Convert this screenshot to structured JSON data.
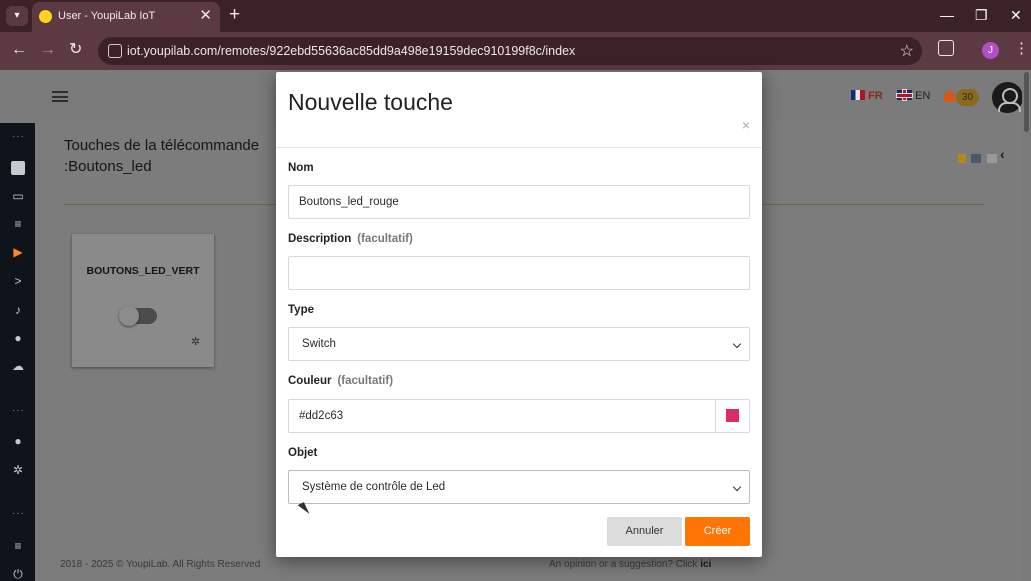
{
  "browser": {
    "tab_title": "User - YoupiLab IoT",
    "tab_close": "✕",
    "new_tab": "+",
    "url": "iot.youpilab.com/remotes/922ebd55636ac85dd9a498e19159dec910199f8c/index",
    "profile_initial": "J",
    "window_controls": {
      "minimize": "—",
      "restore": "❐",
      "close": "✕"
    }
  },
  "header": {
    "languages": [
      {
        "code": "FR",
        "active": true
      },
      {
        "code": "EN",
        "active": false
      }
    ],
    "notification_count": "30"
  },
  "page": {
    "title": "Touches de la télécommande :Boutons_led",
    "cards": [
      {
        "name": "BOUTONS_LED_VERT",
        "state": "off"
      }
    ],
    "footer_left": "2018 - 2025 © YoupiLab. All Rights Reserved",
    "footer_right_text": "An opinion or a suggestion? Click ",
    "footer_right_link": "ici"
  },
  "modal": {
    "title": "Nouvelle touche",
    "close_label": "×",
    "fields": {
      "name": {
        "label": "Nom",
        "value": "Boutons_led_rouge"
      },
      "description": {
        "label": "Description",
        "optional": "(facultatif)",
        "value": ""
      },
      "type": {
        "label": "Type",
        "value": "Switch"
      },
      "color": {
        "label": "Couleur",
        "optional": "(facultatif)",
        "value": "#dd2c63"
      },
      "object": {
        "label": "Objet",
        "value": "Système de contrôle de Led"
      }
    },
    "buttons": {
      "cancel": "Annuler",
      "create": "Créer"
    }
  },
  "colors": {
    "accent": "#ff7504",
    "swatch": "#dd2c63",
    "sidebar": "#0e1419"
  }
}
